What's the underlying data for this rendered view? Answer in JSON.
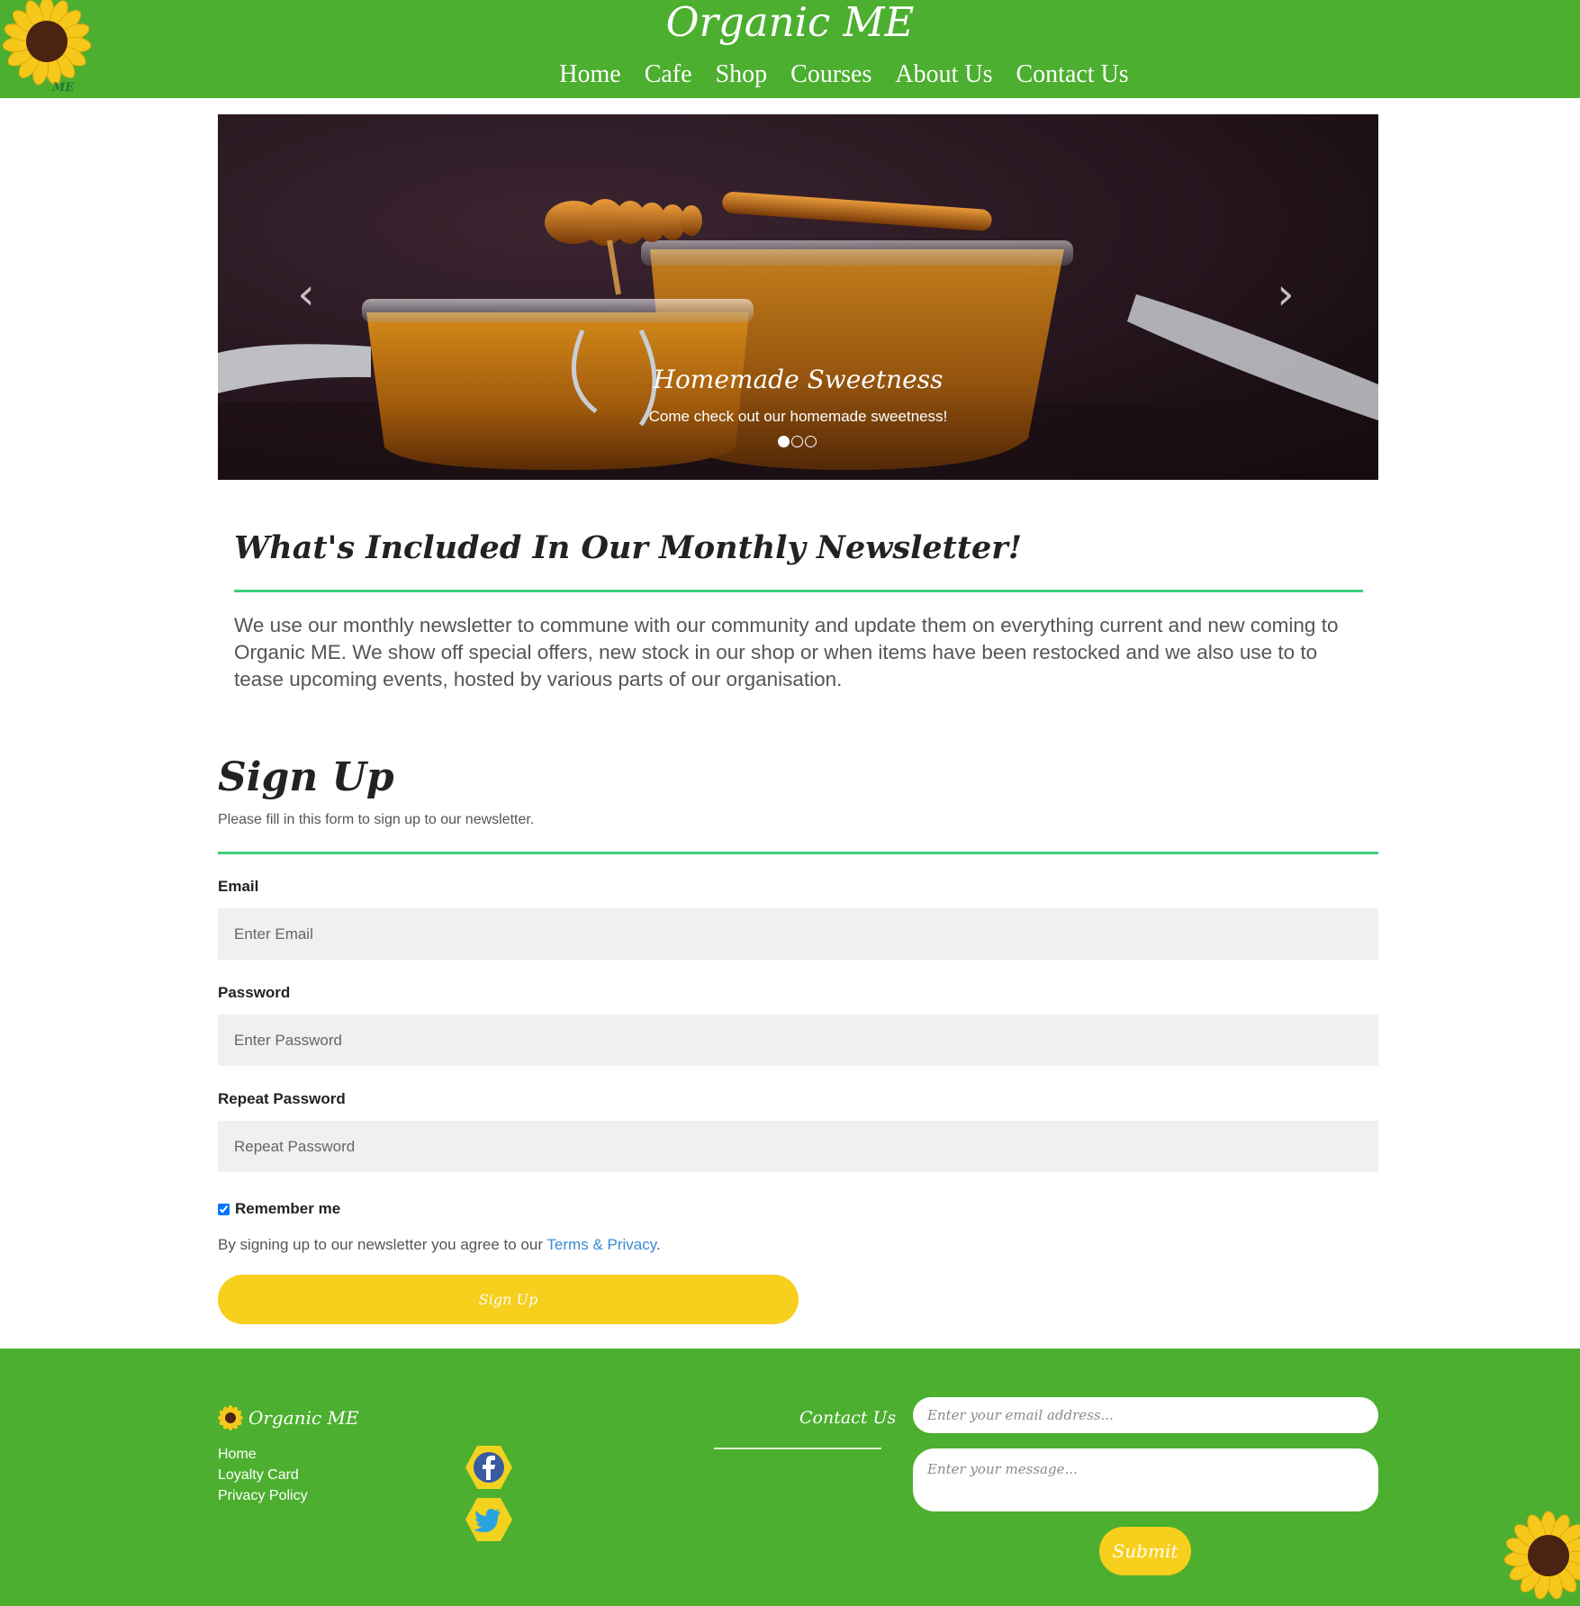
{
  "header": {
    "title": "Organic ME",
    "logo_text": "ME",
    "nav": [
      "Home",
      "Cafe",
      "Shop",
      "Courses",
      "About Us",
      "Contact Us"
    ]
  },
  "carousel": {
    "caption_title": "Homemade Sweetness",
    "caption_text": "Come check out our homemade sweetness!",
    "slide_count": 3,
    "active_slide": 1,
    "prev_icon": "chevron-left-icon",
    "next_icon": "chevron-right-icon"
  },
  "newsletter": {
    "heading": "What's Included In Our Monthly Newsletter!",
    "body": "We use our monthly newsletter to commune with our community and update them on everything current and new coming to Organic ME. We show off special offers, new stock in our shop or when items have been restocked and we also use to to tease upcoming events, hosted by various parts of our organisation."
  },
  "signup": {
    "title": "Sign Up",
    "subtitle": "Please fill in this form to sign up to our newsletter.",
    "email_label": "Email",
    "email_placeholder": "Enter Email",
    "password_label": "Password",
    "password_placeholder": "Enter Password",
    "repeat_label": "Repeat Password",
    "repeat_placeholder": "Repeat Password",
    "remember_label": "Remember me",
    "remember_checked": true,
    "terms_prefix": "By signing up to our newsletter you agree to our ",
    "terms_link": "Terms & Privacy",
    "terms_suffix": ".",
    "button": "Sign Up"
  },
  "footer": {
    "brand": "Organic ME",
    "links": [
      "Home",
      "Loyalty Card",
      "Privacy Policy"
    ],
    "social": [
      "facebook-icon",
      "twitter-icon"
    ],
    "contact_title": "Contact Us",
    "email_placeholder": "Enter your email address...",
    "message_placeholder": "Enter your message...",
    "submit": "Submit"
  },
  "colors": {
    "brand_green": "#4caf2f",
    "accent_yellow": "#f7cf1d",
    "rule_green": "#3ecf7a",
    "link_blue": "#3b8ad6"
  }
}
